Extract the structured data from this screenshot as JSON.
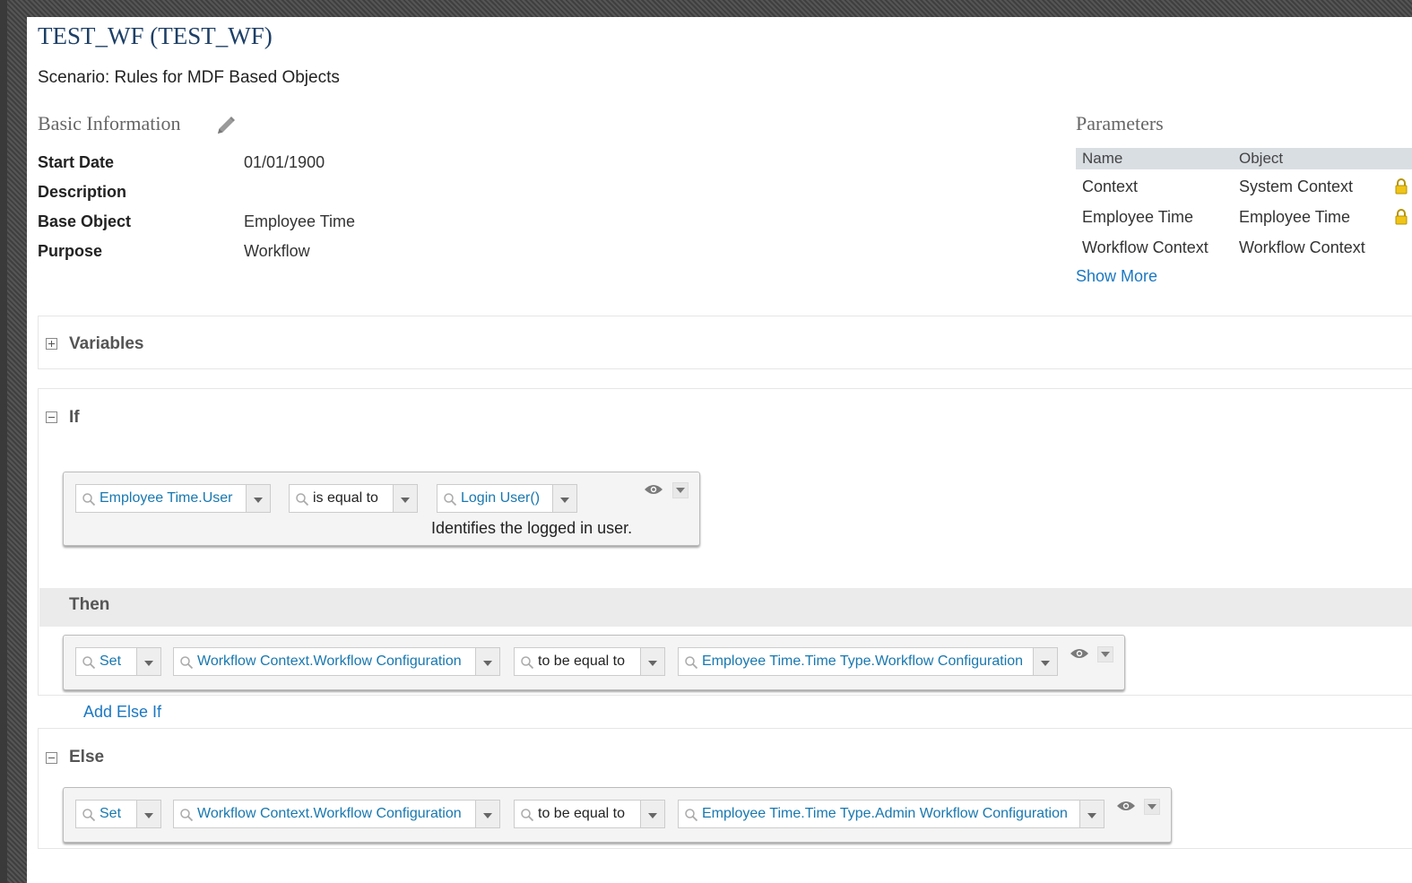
{
  "header": {
    "title": "TEST_WF (TEST_WF)",
    "scenario": "Scenario: Rules for MDF Based Objects"
  },
  "basic_info": {
    "heading": "Basic Information",
    "fields": [
      {
        "label": "Start Date",
        "value": "01/01/1900"
      },
      {
        "label": "Description",
        "value": ""
      },
      {
        "label": "Base Object",
        "value": "Employee Time"
      },
      {
        "label": "Purpose",
        "value": "Workflow"
      }
    ]
  },
  "parameters": {
    "heading": "Parameters",
    "columns": [
      "Name",
      "Object"
    ],
    "rows": [
      {
        "name": "Context",
        "object": "System Context",
        "locked": true
      },
      {
        "name": "Employee Time",
        "object": "Employee Time",
        "locked": true
      },
      {
        "name": "Workflow Context",
        "object": "Workflow Context",
        "locked": false
      }
    ],
    "show_more": "Show More"
  },
  "variables": {
    "title": "Variables",
    "expanded": false
  },
  "if_block": {
    "title": "If",
    "condition": {
      "left": "Employee Time.User",
      "operator": "is equal to",
      "right": "Login User()",
      "description": "Identifies the logged in user."
    }
  },
  "then_block": {
    "title": "Then",
    "action": {
      "verb": "Set",
      "target": "Workflow Context.Workflow Configuration",
      "operator": "to be equal to",
      "value": "Employee Time.Time Type.Workflow Configuration"
    }
  },
  "add_else_if": "Add Else If",
  "else_block": {
    "title": "Else",
    "action": {
      "verb": "Set",
      "target": "Workflow Context.Workflow Configuration",
      "operator": "to be equal to",
      "value": "Employee Time.Time Type.Admin Workflow Configuration"
    }
  },
  "colors": {
    "title": "#1d3f66",
    "link": "#1b78c2",
    "field_link": "#1878b0",
    "table_header": "#d9dee3",
    "then_bar": "#ebebeb"
  }
}
